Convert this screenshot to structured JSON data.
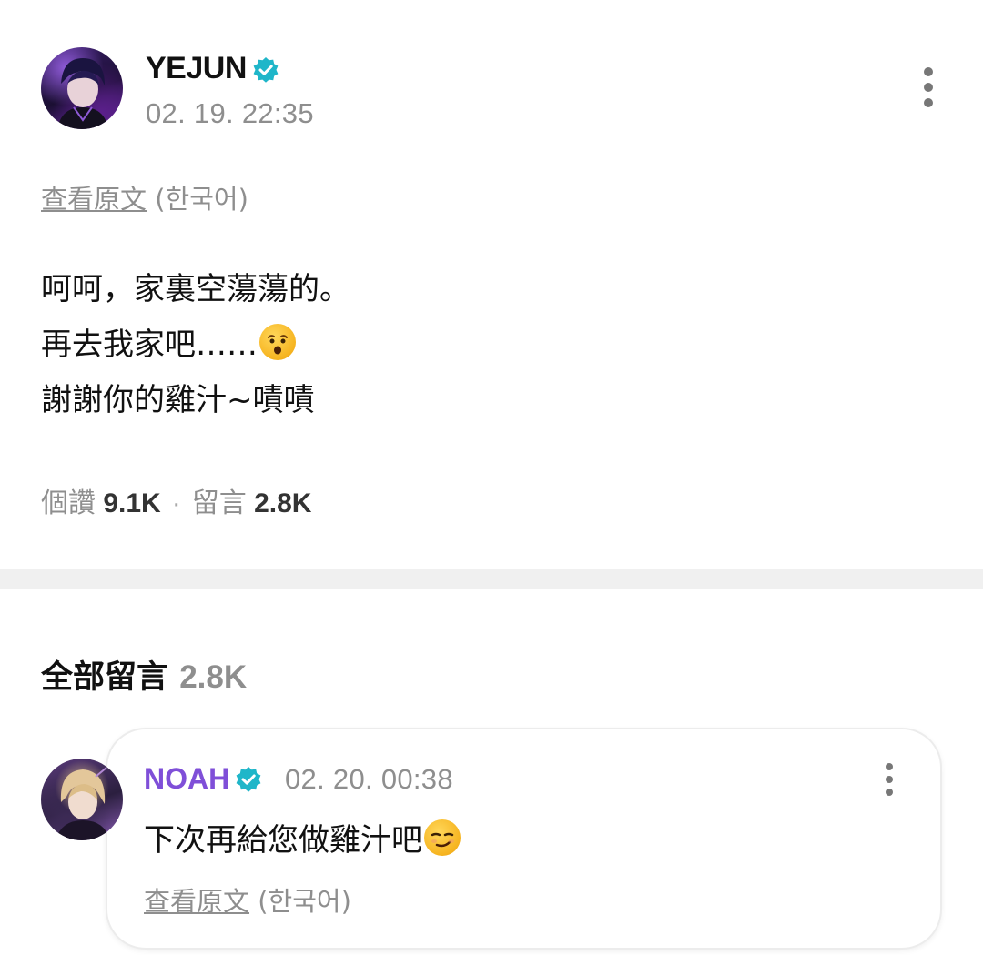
{
  "post": {
    "author": "YEJUN",
    "verified": true,
    "timestamp": "02. 19. 22:35",
    "translate_link": "查看原文",
    "translate_lang": "(한국어)",
    "lines": [
      "呵呵，家裏空蕩蕩的。",
      "再去我家吧……",
      "謝謝你的雞汁~嘖嘖"
    ],
    "emoji_icon": "astonished-face-emoji",
    "likes_label": "個讚",
    "likes_count": "9.1K",
    "separator": "·",
    "comments_label": "留言",
    "comments_count": "2.8K"
  },
  "comments_section": {
    "heading": "全部留言",
    "count": "2.8K"
  },
  "comment": {
    "author": "NOAH",
    "verified": true,
    "timestamp": "02. 20. 00:38",
    "text": "下次再給您做雞汁吧",
    "emoji_icon": "smirking-face-emoji",
    "translate_link": "查看原文",
    "translate_lang": "(한국어)"
  },
  "colors": {
    "verified_badge": "#1fb6c9",
    "comment_author": "#7f4fd8",
    "muted_text": "#8e8e8e",
    "divider": "#f0f0f0"
  }
}
